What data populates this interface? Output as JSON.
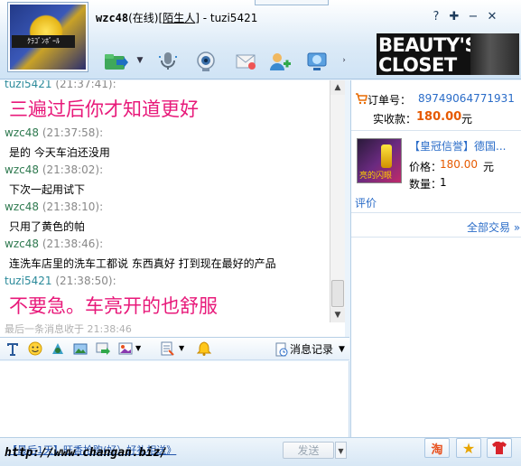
{
  "window": {
    "contact_name": "wzc48",
    "status": "(在线)",
    "stranger_tag": "陌生人",
    "separator": " - ",
    "self_name": "tuzi5421",
    "avatar_badge_text": "ｸﾗｺﾞﾝﾎﾞｰﾙ"
  },
  "title_buttons": [
    {
      "icon": "help-icon",
      "glyph": "?"
    },
    {
      "icon": "pin-icon",
      "glyph": "✚"
    },
    {
      "icon": "minimize-icon",
      "glyph": "−"
    },
    {
      "icon": "close-icon",
      "glyph": "✕"
    }
  ],
  "toolbar": {
    "tools": [
      "send-file-icon",
      "voice-call-icon",
      "video-call-icon",
      "email-icon",
      "add-contact-icon",
      "remote-assist-icon"
    ],
    "more_glyph": "›",
    "dropdown_glyph": "▼"
  },
  "ad": {
    "text_line1": "BEAUTY'S",
    "text_line2": "CLOSET"
  },
  "messages": [
    {
      "name": "tuzi5421",
      "time": "(21:37:41):",
      "text": "三遍过后你才知道更好",
      "style": "big",
      "self": true
    },
    {
      "name": "wzc48",
      "time": "(21:37:58):",
      "text": "是的 今天车泊还没用",
      "style": "normal",
      "self": false
    },
    {
      "name": "wzc48",
      "time": "(21:38:02):",
      "text": "下次一起用试下",
      "style": "normal",
      "self": false
    },
    {
      "name": "wzc48",
      "time": "(21:38:10):",
      "text": "只用了黄色的帕",
      "style": "normal",
      "self": false
    },
    {
      "name": "wzc48",
      "time": "(21:38:46):",
      "text": "连洗车店里的洗车工都说 东西真好 打到现在最好的产品",
      "style": "normal",
      "self": false
    },
    {
      "name": "tuzi5421",
      "time": "(21:38:50):",
      "text": "不要急。车亮开的也舒服",
      "style": "big",
      "self": true
    }
  ],
  "scroll": {
    "up_glyph": "▲",
    "down_glyph": "▼"
  },
  "last_message_status": "最后一条消息收于 21:38:46",
  "input_toolbar": {
    "tools": [
      "font-icon",
      "emoticon-icon",
      "magic-emoticon-icon",
      "screenshot-icon",
      "send-picture-icon",
      "picture-icon",
      "preset-reply-icon",
      "nudge-icon"
    ],
    "dropdown_glyph": "▼",
    "record_label": "消息记录",
    "record_arrow": "▼"
  },
  "bottom": {
    "link_text": "【最后1天】旺香抢购(好）好礼相送》",
    "watermark": "http://www.changan.biz/",
    "send_label": "发送",
    "send_arrow": "▼",
    "side_buttons": [
      {
        "icon": "taobao-icon",
        "glyph": "淘",
        "color": "#e8511e"
      },
      {
        "icon": "favorite-star-icon",
        "glyph": "★",
        "color": "#e8a400"
      },
      {
        "icon": "clothing-icon",
        "glyph": "👕",
        "color": "#d8232a"
      }
    ]
  },
  "order": {
    "order_label": "订单号：",
    "order_number": "89749064771931",
    "paid_label": "实收款：",
    "paid_amount": "180.00",
    "paid_unit": "元",
    "product_title": "【皇冠信誉】德国...",
    "product_thumb_label": "亮的闪眼",
    "price_label": "价格：",
    "price_value": "180.00",
    "price_unit": "元",
    "qty_label": "数量：",
    "qty_value": "1",
    "rate_link": "评价",
    "all_trades_link": "全部交易 »"
  },
  "colors": {
    "accent_pink": "#e8197a",
    "price_orange": "#e65a00",
    "link_blue": "#2a6cc8",
    "name_green": "#2f7a50"
  }
}
